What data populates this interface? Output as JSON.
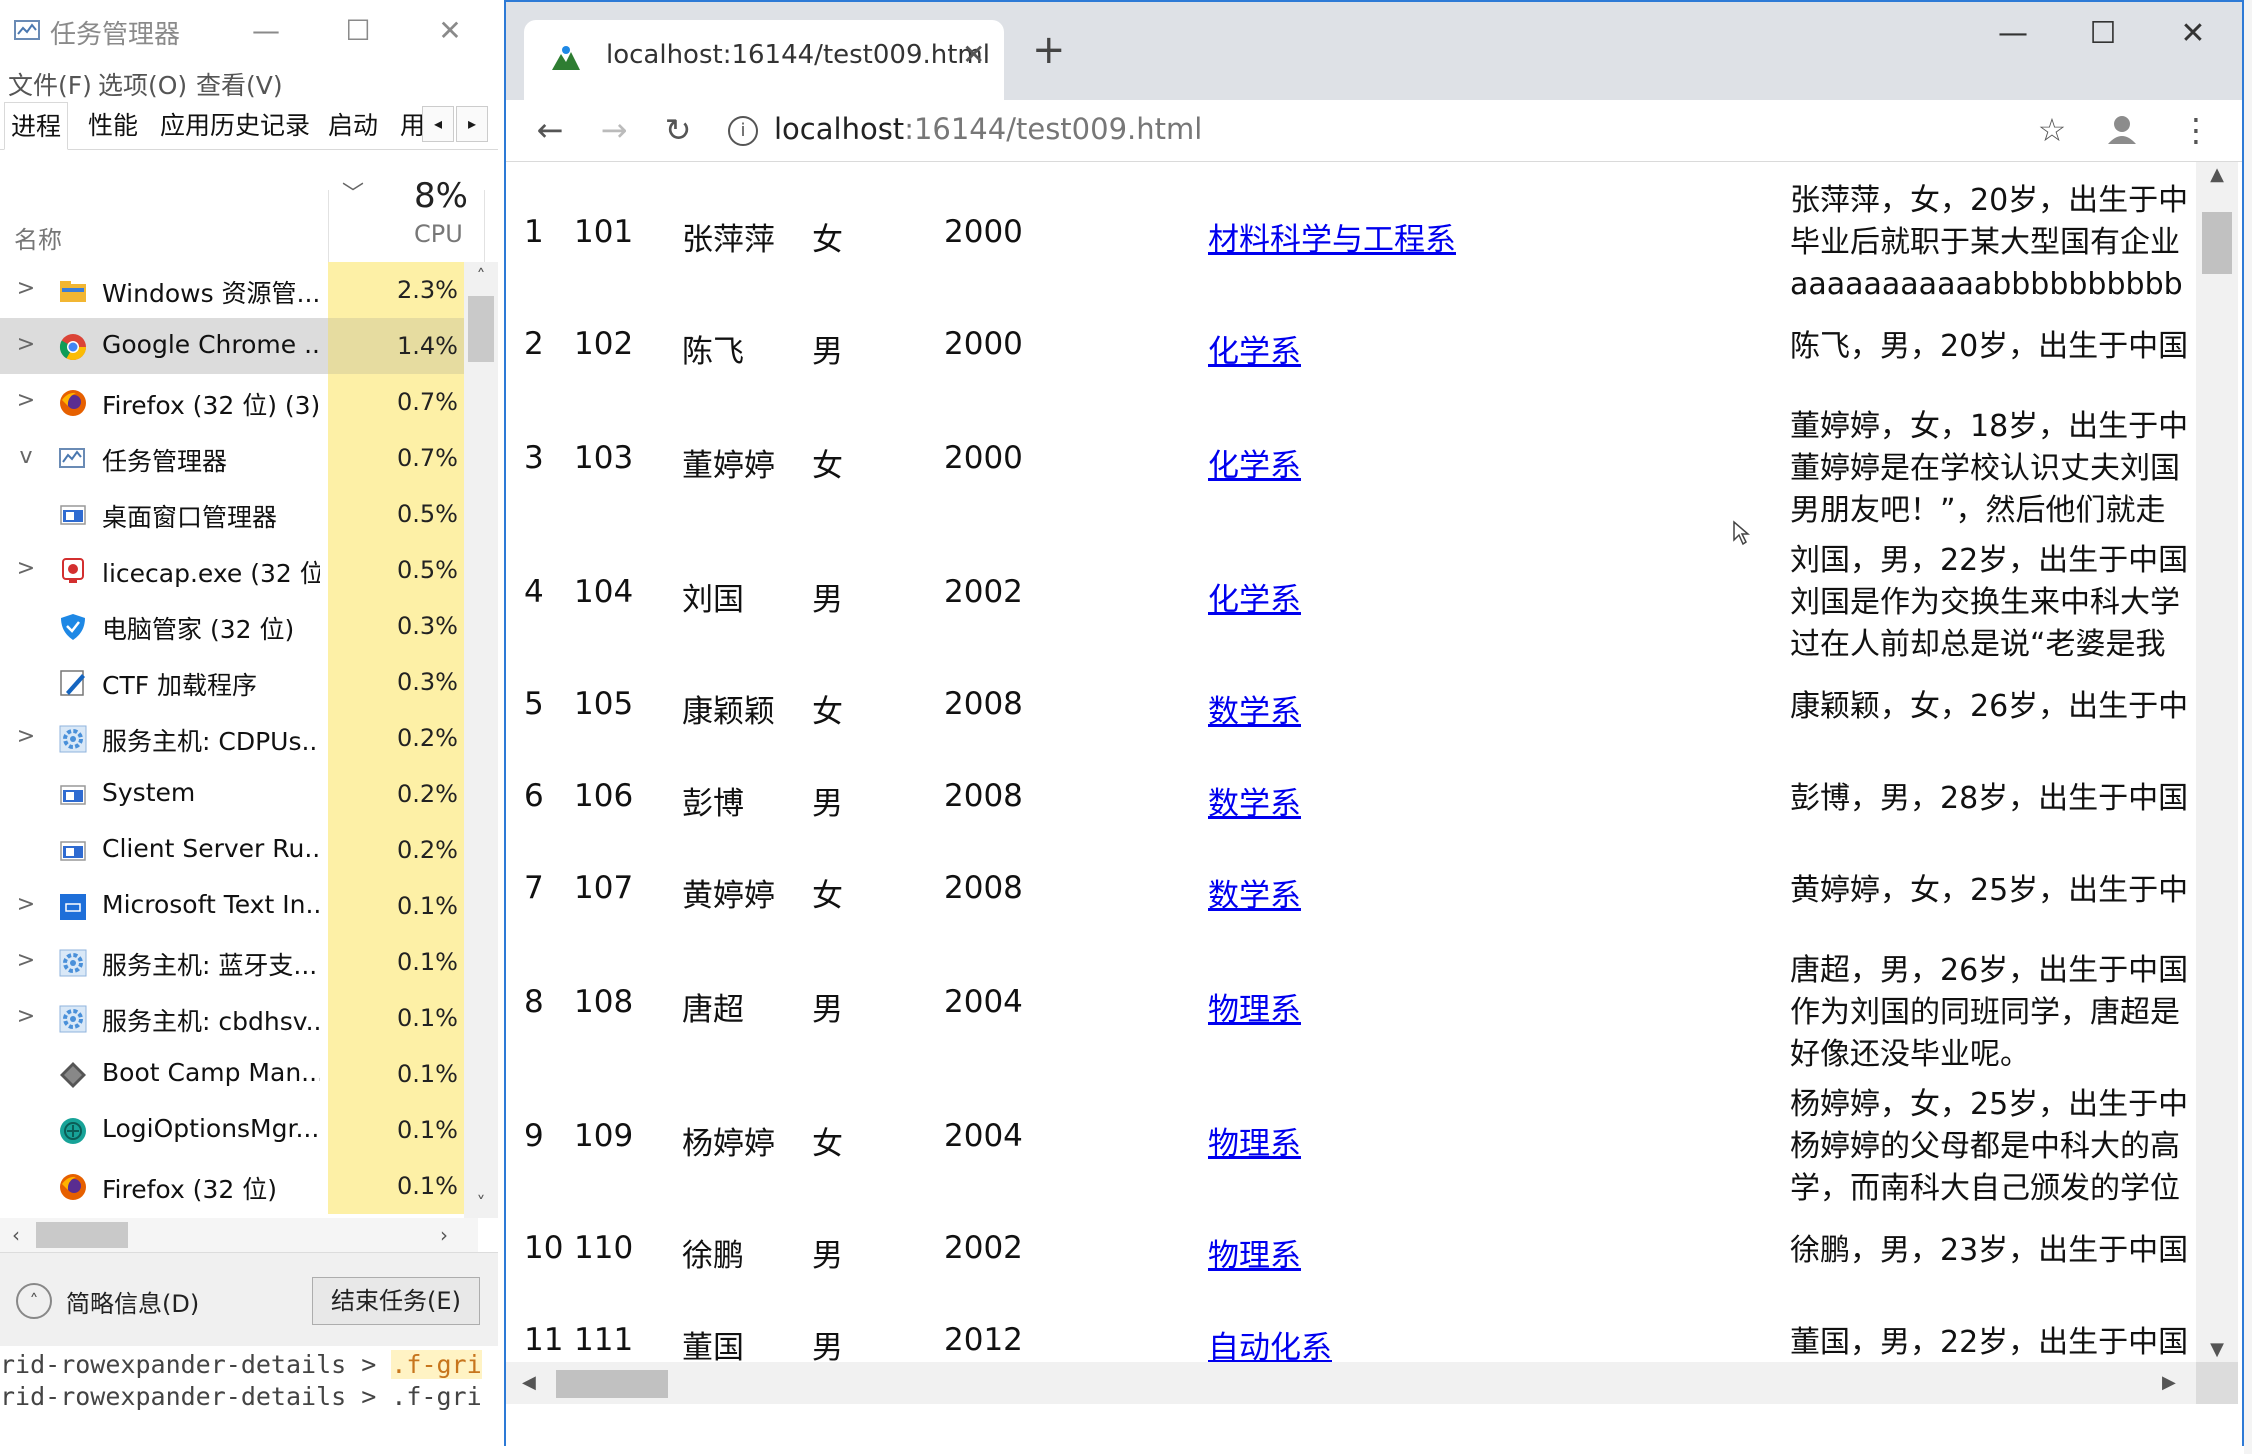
{
  "task_manager": {
    "title": "任务管理器",
    "menu": [
      "文件(F)",
      "选项(O)",
      "查看(V)"
    ],
    "tabs": [
      "进程",
      "性能",
      "应用历史记录",
      "启动",
      "用"
    ],
    "active_tab": "进程",
    "columns": {
      "name": "名称",
      "cpu_percent": "8%",
      "cpu": "CPU"
    },
    "processes": [
      {
        "name": "Windows 资源管...",
        "cpu": "2.3%",
        "expander": ">",
        "icon": "folder-icon",
        "icon_color": "#f2b632"
      },
      {
        "name": "Google Chrome ...",
        "cpu": "1.4%",
        "expander": ">",
        "icon": "chrome-icon",
        "icon_color": "#db4437",
        "selected": true
      },
      {
        "name": "Firefox (32 位) (3)",
        "cpu": "0.7%",
        "expander": ">",
        "icon": "firefox-icon",
        "icon_color": "#e66000"
      },
      {
        "name": "任务管理器",
        "cpu": "0.7%",
        "expander": "v",
        "icon": "task-manager-icon",
        "icon_color": "#6a8bb5"
      },
      {
        "name": "桌面窗口管理器",
        "cpu": "0.5%",
        "expander": "",
        "icon": "window-icon",
        "icon_color": "#2f6bd1"
      },
      {
        "name": "licecap.exe (32 位)",
        "cpu": "0.5%",
        "expander": ">",
        "icon": "licecap-icon",
        "icon_color": "#d32f2f"
      },
      {
        "name": "电脑管家 (32 位)",
        "cpu": "0.3%",
        "expander": "",
        "icon": "shield-icon",
        "icon_color": "#1e88e5"
      },
      {
        "name": "CTF 加载程序",
        "cpu": "0.3%",
        "expander": "",
        "icon": "pen-icon",
        "icon_color": "#1565c0"
      },
      {
        "name": "服务主机: CDPUs...",
        "cpu": "0.2%",
        "expander": ">",
        "icon": "gear-icon",
        "icon_color": "#4a90d9"
      },
      {
        "name": "System",
        "cpu": "0.2%",
        "expander": "",
        "icon": "window-icon",
        "icon_color": "#2f6bd1"
      },
      {
        "name": "Client Server Ru...",
        "cpu": "0.2%",
        "expander": "",
        "icon": "window-icon",
        "icon_color": "#2f6bd1"
      },
      {
        "name": "Microsoft Text In...",
        "cpu": "0.1%",
        "expander": ">",
        "icon": "text-input-icon",
        "icon_color": "#1e6fd9"
      },
      {
        "name": "服务主机: 蓝牙支...",
        "cpu": "0.1%",
        "expander": ">",
        "icon": "gear-icon",
        "icon_color": "#4a90d9"
      },
      {
        "name": "服务主机: cbdhsv...",
        "cpu": "0.1%",
        "expander": ">",
        "icon": "gear-icon",
        "icon_color": "#4a90d9"
      },
      {
        "name": "Boot Camp Man...",
        "cpu": "0.1%",
        "expander": "",
        "icon": "diamond-icon",
        "icon_color": "#555555"
      },
      {
        "name": "LogiOptionsMgr....",
        "cpu": "0.1%",
        "expander": "",
        "icon": "logi-icon",
        "icon_color": "#17a398"
      },
      {
        "name": "Firefox (32 位)",
        "cpu": "0.1%",
        "expander": "",
        "icon": "firefox-icon",
        "icon_color": "#e66000"
      }
    ],
    "footer": {
      "fewer_details": "简略信息(D)",
      "end_task": "结束任务(E)"
    }
  },
  "console": {
    "line1_prefix": "rid-rowexpander-details > ",
    "line1_highlight": ".f-gri",
    "line2": "rid-rowexpander-details > .f-gri"
  },
  "browser": {
    "tab_title": "localhost:16144/test009.html",
    "url_host": "localhost",
    "url_rest": ":16144/test009.html",
    "new_tab": "+",
    "accent": "#2d7ad6"
  },
  "students": [
    {
      "idx": "1",
      "id": "101",
      "name": "张萍萍",
      "gender": "女",
      "year": "2000",
      "dept": "材料科学与工程系",
      "intro": [
        "张萍萍，女，20岁，出生于中",
        "毕业后就职于某大型国有企业",
        "aaaaaaaaaaabbbbbbbbbb"
      ]
    },
    {
      "idx": "2",
      "id": "102",
      "name": "陈飞",
      "gender": "男",
      "year": "2000",
      "dept": "化学系",
      "intro": [
        "陈飞，男，20岁，出生于中国"
      ]
    },
    {
      "idx": "3",
      "id": "103",
      "name": "董婷婷",
      "gender": "女",
      "year": "2000",
      "dept": "化学系",
      "intro": [
        "董婷婷，女，18岁，出生于中",
        "董婷婷是在学校认识丈夫刘国",
        "男朋友吧！”，然后他们就走"
      ]
    },
    {
      "idx": "4",
      "id": "104",
      "name": "刘国",
      "gender": "男",
      "year": "2002",
      "dept": "化学系",
      "intro": [
        "刘国，男，22岁，出生于中国",
        "刘国是作为交换生来中科大学",
        "过在人前却总是说“老婆是我"
      ]
    },
    {
      "idx": "5",
      "id": "105",
      "name": "康颖颖",
      "gender": "女",
      "year": "2008",
      "dept": "数学系",
      "intro": [
        "康颖颖，女，26岁，出生于中"
      ]
    },
    {
      "idx": "6",
      "id": "106",
      "name": "彭博",
      "gender": "男",
      "year": "2008",
      "dept": "数学系",
      "intro": [
        "彭博，男，28岁，出生于中国"
      ]
    },
    {
      "idx": "7",
      "id": "107",
      "name": "黄婷婷",
      "gender": "女",
      "year": "2008",
      "dept": "数学系",
      "intro": [
        "黄婷婷，女，25岁，出生于中"
      ]
    },
    {
      "idx": "8",
      "id": "108",
      "name": "唐超",
      "gender": "男",
      "year": "2004",
      "dept": "物理系",
      "intro": [
        "唐超，男，26岁，出生于中国",
        "作为刘国的同班同学，唐超是",
        "好像还没毕业呢。"
      ]
    },
    {
      "idx": "9",
      "id": "109",
      "name": "杨婷婷",
      "gender": "女",
      "year": "2004",
      "dept": "物理系",
      "intro": [
        "杨婷婷，女，25岁，出生于中",
        "杨婷婷的父母都是中科大的高",
        "学，而南科大自己颁发的学位"
      ]
    },
    {
      "idx": "10",
      "id": "110",
      "name": "徐鹏",
      "gender": "男",
      "year": "2002",
      "dept": "物理系",
      "intro": [
        "徐鹏，男，23岁，出生于中国"
      ]
    },
    {
      "idx": "11",
      "id": "111",
      "name": "董国",
      "gender": "男",
      "year": "2012",
      "dept": "自动化系",
      "intro": [
        "董国，男，22岁，出生于中国"
      ]
    }
  ]
}
